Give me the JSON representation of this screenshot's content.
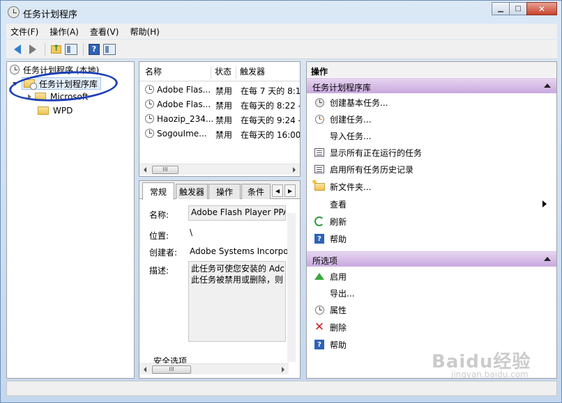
{
  "window": {
    "title": "任务计划程序",
    "minimize": "▁",
    "maximize": "□",
    "close": "✕"
  },
  "menu": [
    "文件(F)",
    "操作(A)",
    "查看(V)",
    "帮助(H)"
  ],
  "toolbar": {
    "icons": [
      "back-arrow-icon",
      "forward-arrow-icon",
      "folder-up-icon",
      "show-hide-console-tree-icon",
      "help-icon",
      "show-hide-action-pane-icon"
    ],
    "help_glyph": "?"
  },
  "tree": {
    "root": "任务计划程序 (本地)",
    "library": "任务计划程序库",
    "children": [
      "Microsoft",
      "WPD"
    ]
  },
  "task_list": {
    "columns": [
      "名称",
      "状态",
      "触发器"
    ],
    "rows": [
      {
        "name": "Adobe Flas...",
        "status": "禁用",
        "trigger": "在每 7 天的 8:1"
      },
      {
        "name": "Adobe Flas...",
        "status": "禁用",
        "trigger": "在每天的 8:22 -"
      },
      {
        "name": "Haozip_234...",
        "status": "禁用",
        "trigger": "在每天的 9:24 -"
      },
      {
        "name": "SogouIme...",
        "status": "禁用",
        "trigger": "在每天的 16:00"
      }
    ],
    "scroll_thumb": "III"
  },
  "details": {
    "tabs": [
      "常规",
      "触发器",
      "操作",
      "条件"
    ],
    "tab_nav_prev": "◂",
    "tab_nav_next": "▸",
    "fields": {
      "name_label": "名称:",
      "name_value": "Adobe Flash Player PPA",
      "location_label": "位置:",
      "location_value": "\\",
      "author_label": "创建者:",
      "author_value": "Adobe Systems Incorpo",
      "description_label": "描述:",
      "description_line1": "此任务可使您安装的 Adc",
      "description_line2": "此任务被禁用或删除，则"
    },
    "security_label": "安全选项",
    "scroll_thumb": "III"
  },
  "actions": {
    "title": "操作",
    "section1": {
      "header": "任务计划程序库",
      "items": [
        {
          "label": "创建基本任务...",
          "icon": "create-basic-task-icon"
        },
        {
          "label": "创建任务...",
          "icon": "create-task-icon"
        },
        {
          "label": "导入任务...",
          "icon": ""
        },
        {
          "label": "显示所有正在运行的任务",
          "icon": "running-tasks-icon"
        },
        {
          "label": "启用所有任务历史记录",
          "icon": "history-icon"
        },
        {
          "label": "新文件夹...",
          "icon": "new-folder-icon"
        },
        {
          "label": "查看",
          "icon": ""
        },
        {
          "label": "刷新",
          "icon": "refresh-icon"
        },
        {
          "label": "帮助",
          "icon": "help-icon"
        }
      ]
    },
    "section2": {
      "header": "所选项",
      "items": [
        {
          "label": "启用",
          "icon": "enable-icon"
        },
        {
          "label": "导出...",
          "icon": ""
        },
        {
          "label": "属性",
          "icon": "properties-icon"
        },
        {
          "label": "删除",
          "icon": "delete-icon"
        },
        {
          "label": "帮助",
          "icon": "help-icon"
        }
      ]
    }
  },
  "watermark": {
    "brand": "Baidu经验",
    "url": "jingyan.baidu.com"
  },
  "colors": {
    "section_header": "#c8a8de",
    "selection": "#e3eefb",
    "pen_annotation": "#1a3fb5"
  }
}
